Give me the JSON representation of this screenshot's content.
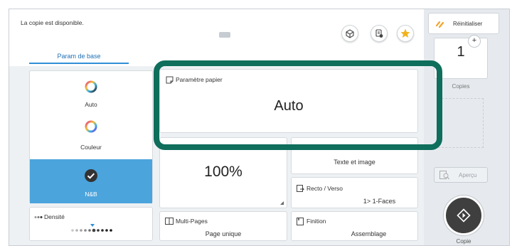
{
  "status": {
    "message": "La copie est disponible."
  },
  "tabs": {
    "base_label": "Param de base"
  },
  "color_mode": {
    "options": [
      {
        "label": "Auto"
      },
      {
        "label": "Couleur"
      },
      {
        "label": "N&B"
      }
    ],
    "selected": "N&B",
    "selected_color": "#4ba4dc"
  },
  "density": {
    "label": "Densité",
    "level_fraction": 0.45
  },
  "paper": {
    "title": "Paramètre papier",
    "value": "Auto"
  },
  "zoom": {
    "value": "100%"
  },
  "original_type": {
    "value": "Texte et image"
  },
  "duplex": {
    "title": "Recto / Verso",
    "value": "1> 1-Faces"
  },
  "multipage": {
    "title": "Multi-Pages",
    "value": "Page unique"
  },
  "finishing": {
    "title": "Finition",
    "value": "Assemblage"
  },
  "right_panel": {
    "reset_label": "Réinitialiser",
    "copies_value": "1",
    "copies_plus": "+",
    "copies_label": "Copies",
    "preview_label": "Aperçu",
    "start_label": "Copie"
  },
  "colors": {
    "highlight": "#0f6e5c",
    "accent": "#2f8fd6",
    "star": "#f2b21b"
  },
  "icons": [
    "box-icon",
    "clipboard-icon",
    "star-icon",
    "reset-icon",
    "preview-icon",
    "start-icon",
    "paper-icon",
    "duplex-icon",
    "multipage-icon",
    "finishing-icon"
  ]
}
